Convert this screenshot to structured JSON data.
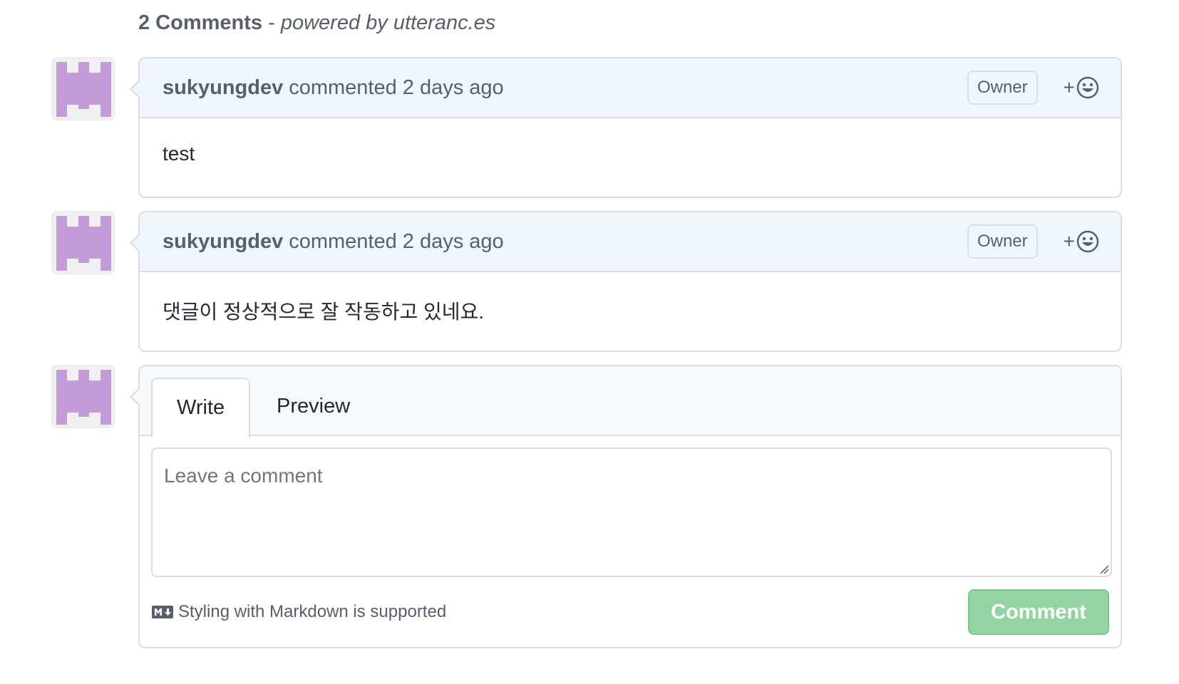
{
  "header": {
    "count_label": "2 Comments",
    "separator": " - ",
    "powered_by": "powered by utteranc.es"
  },
  "comments": [
    {
      "author": "sukyungdev",
      "meta": "commented 2 days ago",
      "badge": "Owner",
      "reaction_plus": "+",
      "reaction_icon": "smiley-icon",
      "body": "test"
    },
    {
      "author": "sukyungdev",
      "meta": "commented 2 days ago",
      "badge": "Owner",
      "reaction_plus": "+",
      "reaction_icon": "smiley-icon",
      "body": "댓글이 정상적으로 잘 작동하고 있네요."
    }
  ],
  "editor": {
    "tabs": [
      {
        "label": "Write",
        "active": true
      },
      {
        "label": "Preview",
        "active": false
      }
    ],
    "placeholder": "Leave a comment",
    "markdown_note": "Styling with Markdown is supported",
    "markdown_icon": "markdown-icon",
    "submit_label": "Comment"
  },
  "colors": {
    "avatar": "#c39bd9",
    "header_bg": "#f1f6fd",
    "border": "#d8dee4",
    "button": "#94d3a2"
  }
}
